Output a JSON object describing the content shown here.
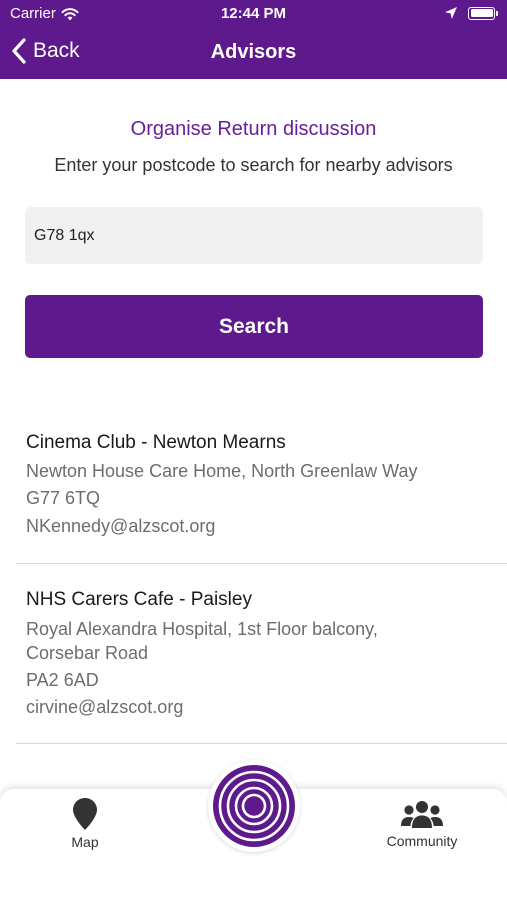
{
  "status_bar": {
    "carrier": "Carrier",
    "time": "12:44 PM",
    "icons": [
      "wifi-icon",
      "location-arrow-icon",
      "battery-icon"
    ]
  },
  "nav": {
    "back_label": "Back",
    "title": "Advisors"
  },
  "main": {
    "subtitle": "Organise Return discussion",
    "instructions": "Enter your postcode to search for nearby advisors",
    "postcode_value": "G78 1qx",
    "search_label": "Search"
  },
  "results": [
    {
      "name": "Cinema Club - Newton Mearns",
      "address_lines": [
        "Newton House Care Home, North Greenlaw Way"
      ],
      "postcode": "G77 6TQ",
      "email": "NKennedy@alzscot.org"
    },
    {
      "name": "NHS Carers Cafe - Paisley",
      "address_lines": [
        "Royal Alexandra Hospital, 1st Floor balcony,",
        "Corsebar Road"
      ],
      "postcode": "PA2 6AD",
      "email": "cirvine@alzscot.org"
    }
  ],
  "tabbar": {
    "map_label": "Map",
    "community_label": "Community",
    "icons": [
      "map-pin-icon",
      "target-rings-icon",
      "community-icon"
    ]
  },
  "colors": {
    "brand_purple": "#5e1a8c",
    "subtitle_purple": "#6a1f9a",
    "input_bg": "#f1f1f1",
    "secondary_text": "#6d6d6d"
  }
}
